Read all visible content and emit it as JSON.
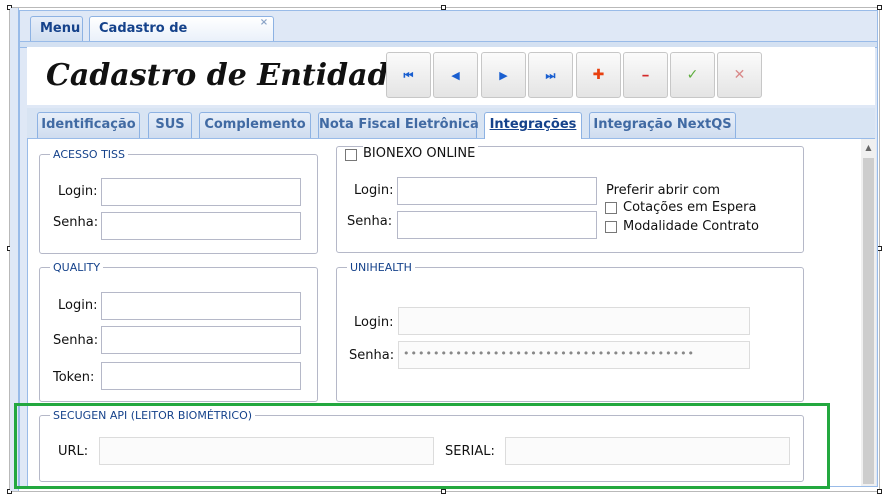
{
  "tabs": {
    "menu": "Menu",
    "cadastro": "Cadastro de Entidades",
    "close_symbol": "×"
  },
  "title": "Cadastro de Entidades",
  "toolbar": [
    {
      "name": "first-record-button",
      "icon": "first-icon",
      "glyph": "⏮"
    },
    {
      "name": "previous-record-button",
      "icon": "previous-icon",
      "glyph": "◀"
    },
    {
      "name": "next-record-button",
      "icon": "next-icon",
      "glyph": "▶"
    },
    {
      "name": "last-record-button",
      "icon": "last-icon",
      "glyph": "⏭"
    },
    {
      "name": "add-button",
      "icon": "plus-icon",
      "glyph": "✚"
    },
    {
      "name": "remove-button",
      "icon": "minus-icon",
      "glyph": "━"
    },
    {
      "name": "confirm-button",
      "icon": "check-icon",
      "glyph": "✓"
    },
    {
      "name": "cancel-button",
      "icon": "close-icon",
      "glyph": "✕"
    }
  ],
  "colors": {
    "nav": "#1a5fd0",
    "add": "#e8400f",
    "remove": "#d42a2a",
    "confirm": "#5fae3f",
    "cancel": "#d98a8a",
    "highlight": "#23a83f"
  },
  "subtabs": [
    "Identificação",
    "SUS",
    "Complemento",
    "Nota Fiscal Eletrônica",
    "Integrações",
    "Integração NextQS"
  ],
  "acesso_tiss": {
    "legend": "ACESSO TISS",
    "login_label": "Login:",
    "senha_label": "Senha:",
    "login_value": "",
    "senha_value": ""
  },
  "bionexo": {
    "legend": "BIONEXO ONLINE",
    "login_label": "Login:",
    "senha_label": "Senha:",
    "preferir": "Preferir abrir com",
    "opt1": "Cotações em Espera",
    "opt2": "Modalidade Contrato",
    "login_value": "",
    "senha_value": ""
  },
  "quality": {
    "legend": "QUALITY",
    "login_label": "Login:",
    "senha_label": "Senha:",
    "token_label": "Token:"
  },
  "unihealth": {
    "legend": "UNIHEALTH",
    "login_label": "Login:",
    "senha_label": "Senha:",
    "senha_value": "•••••••••••••••••••••••••••••••••••••••"
  },
  "secugen": {
    "legend": "SECUGEN API (LEITOR BIOMÉTRICO)",
    "url_label": "URL:",
    "serial_label": "SERIAL:",
    "url_value": "",
    "serial_value": ""
  }
}
